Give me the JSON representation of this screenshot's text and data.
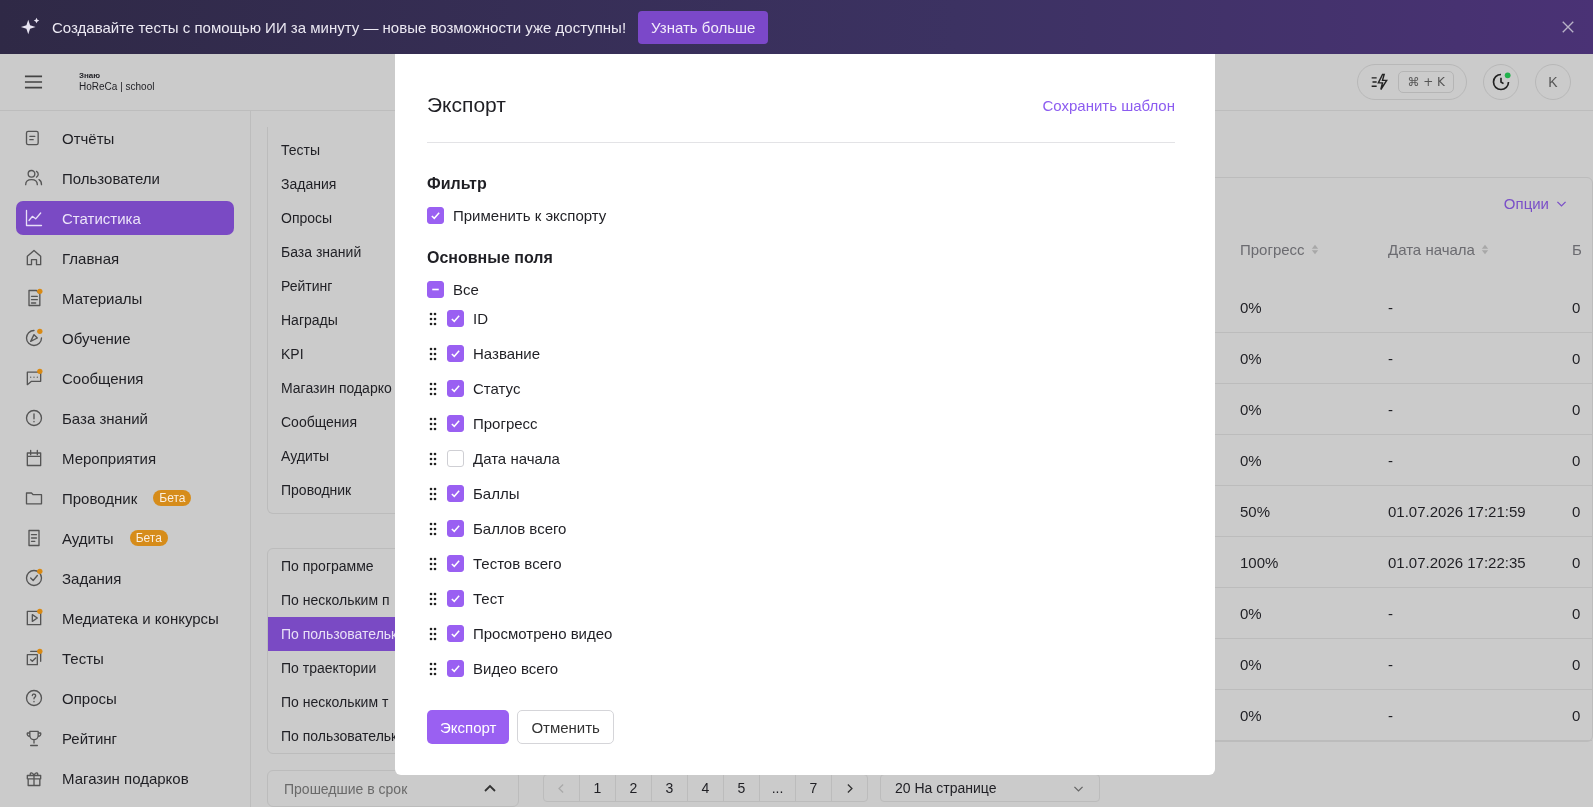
{
  "banner": {
    "text": "Создавайте тесты с помощью ИИ за минуту — новые возможности уже доступны!",
    "button": "Узнать больше"
  },
  "header": {
    "logo_small": "Знаю",
    "logo": "HoReCa | school",
    "shortcut": "⌘ + K",
    "avatar": "K"
  },
  "sidebar": {
    "items": [
      {
        "label": "Отчёты",
        "selected": false,
        "dot": false
      },
      {
        "label": "Пользователи",
        "selected": false,
        "dot": false
      },
      {
        "label": "Статистика",
        "selected": true,
        "dot": false
      },
      {
        "label": "Главная",
        "selected": false,
        "dot": false
      },
      {
        "label": "Материалы",
        "selected": false,
        "dot": true
      },
      {
        "label": "Обучение",
        "selected": false,
        "dot": true
      },
      {
        "label": "Сообщения",
        "selected": false,
        "dot": true
      },
      {
        "label": "База знаний",
        "selected": false,
        "dot": false
      },
      {
        "label": "Мероприятия",
        "selected": false,
        "dot": false
      },
      {
        "label": "Проводник",
        "selected": false,
        "dot": false,
        "badge": "Бета"
      },
      {
        "label": "Аудиты",
        "selected": false,
        "dot": false,
        "badge": "Бета"
      },
      {
        "label": "Задания",
        "selected": false,
        "dot": true
      },
      {
        "label": "Медиатека и конкурсы",
        "selected": false,
        "dot": true
      },
      {
        "label": "Тесты",
        "selected": false,
        "dot": true
      },
      {
        "label": "Опросы",
        "selected": false,
        "dot": false
      },
      {
        "label": "Рейтинг",
        "selected": false,
        "dot": false
      },
      {
        "label": "Магазин подарков",
        "selected": false,
        "dot": false
      }
    ]
  },
  "sections": {
    "items": [
      {
        "label": "Тесты",
        "selected": false
      },
      {
        "label": "Задания",
        "selected": false
      },
      {
        "label": "Опросы",
        "selected": false
      },
      {
        "label": "База знаний",
        "selected": false
      },
      {
        "label": "Рейтинг",
        "selected": false
      },
      {
        "label": "Награды",
        "selected": false
      },
      {
        "label": "KPI",
        "selected": false
      },
      {
        "label": "Магазин подарко",
        "selected": false
      },
      {
        "label": "Сообщения",
        "selected": false
      },
      {
        "label": "Аудиты",
        "selected": false
      },
      {
        "label": "Проводник",
        "selected": false
      }
    ]
  },
  "reports": {
    "items": [
      {
        "label": "По программе",
        "selected": false
      },
      {
        "label": "По нескольким п",
        "selected": false
      },
      {
        "label": "По пользовательк",
        "selected": true
      },
      {
        "label": "По траектории",
        "selected": false
      },
      {
        "label": "По нескольким т",
        "selected": false
      },
      {
        "label": "По пользовательк",
        "selected": false
      }
    ]
  },
  "filter_panel": {
    "title": "Прошедшие в срок",
    "expanded": true
  },
  "table": {
    "options": "Опции",
    "columns": [
      "Прогресс",
      "Дата начала",
      "Б"
    ],
    "rows": [
      [
        "0%",
        "-",
        "0"
      ],
      [
        "0%",
        "-",
        "0"
      ],
      [
        "0%",
        "-",
        "0"
      ],
      [
        "0%",
        "-",
        "0"
      ],
      [
        "50%",
        "01.07.2026 17:21:59",
        "0"
      ],
      [
        "100%",
        "01.07.2026 17:22:35",
        "0"
      ],
      [
        "0%",
        "-",
        "0"
      ],
      [
        "0%",
        "-",
        "0"
      ],
      [
        "0%",
        "-",
        "0"
      ]
    ]
  },
  "pagination": {
    "pages": [
      "1",
      "2",
      "3",
      "4",
      "5",
      "...",
      "7"
    ],
    "per_page": "20 На странице"
  },
  "dialog": {
    "title": "Экспорт",
    "save_template": "Сохранить шаблон",
    "filter_heading": "Фильтр",
    "filter_option": {
      "label": "Применить к экспорту",
      "checked": true
    },
    "fields_heading": "Основные поля",
    "all": {
      "label": "Все",
      "indeterminate": true
    },
    "fields": [
      {
        "label": "ID",
        "checked": true
      },
      {
        "label": "Название",
        "checked": true
      },
      {
        "label": "Статус",
        "checked": true
      },
      {
        "label": "Прогресс",
        "checked": true
      },
      {
        "label": "Дата начала",
        "checked": false
      },
      {
        "label": "Баллы",
        "checked": true
      },
      {
        "label": "Баллов всего",
        "checked": true
      },
      {
        "label": "Тестов всего",
        "checked": true
      },
      {
        "label": "Тест",
        "checked": true
      },
      {
        "label": "Просмотрено видео",
        "checked": true
      },
      {
        "label": "Видео всего",
        "checked": true
      }
    ],
    "buttons": {
      "primary": "Экспорт",
      "secondary": "Отменить"
    }
  }
}
